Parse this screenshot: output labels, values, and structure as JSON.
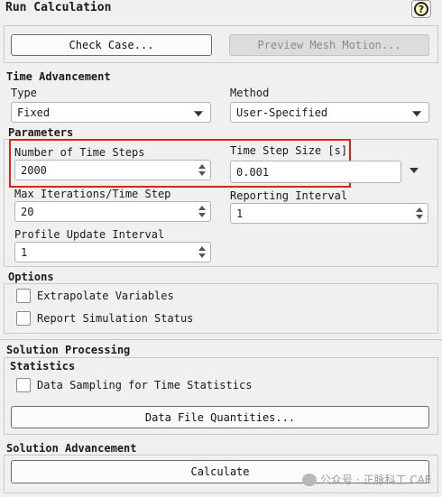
{
  "panel": {
    "title": "Run Calculation",
    "help_icon": "help-icon",
    "help_glyph": "?"
  },
  "top_buttons": {
    "check_case": "Check Case...",
    "preview_mesh": "Preview Mesh Motion..."
  },
  "time_advancement": {
    "section_label": "Time Advancement",
    "type_label": "Type",
    "type_value": "Fixed",
    "method_label": "Method",
    "method_value": "User-Specified"
  },
  "parameters": {
    "section_label": "Parameters",
    "num_steps_label": "Number of Time Steps",
    "num_steps_value": "2000",
    "step_size_label": "Time Step Size [s]",
    "step_size_value": "0.001",
    "max_iter_label": "Max Iterations/Time Step",
    "max_iter_value": "20",
    "reporting_label": "Reporting Interval",
    "reporting_value": "1",
    "profile_label": "Profile Update Interval",
    "profile_value": "1"
  },
  "options": {
    "section_label": "Options",
    "extrapolate_label": "Extrapolate Variables",
    "report_status_label": "Report Simulation Status"
  },
  "solution_processing": {
    "section_label": "Solution Processing",
    "statistics_label": "Statistics",
    "data_sampling_label": "Data Sampling for Time Statistics",
    "data_file_button": "Data File Quantities..."
  },
  "solution_advancement": {
    "section_label": "Solution Advancement",
    "calculate_button": "Calculate"
  },
  "watermark": {
    "text": "公众号 · 正脉科工 CAE"
  },
  "colors": {
    "highlight": "#e0201c",
    "background": "#f0f0f0"
  }
}
